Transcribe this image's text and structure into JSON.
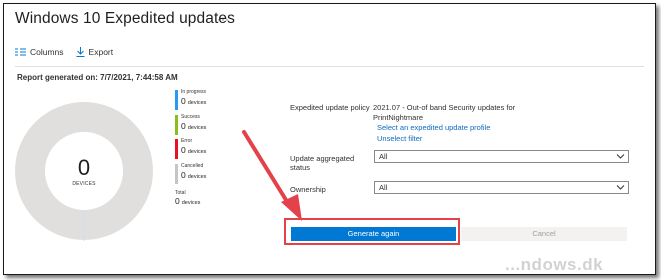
{
  "header": {
    "title": "Windows 10 Expedited updates",
    "more": "···"
  },
  "toolbar": {
    "columns": "Columns",
    "export": "Export"
  },
  "report": {
    "generated": "Report generated on: 7/7/2021, 7:44:58 AM"
  },
  "donut": {
    "total": "0",
    "label": "DEVICES"
  },
  "legend": [
    {
      "name": "In progress",
      "count": "0",
      "unit": "devices",
      "color": "#2899f5"
    },
    {
      "name": "Success",
      "count": "0",
      "unit": "devices",
      "color": "#8cbd18"
    },
    {
      "name": "Error",
      "count": "0",
      "unit": "devices",
      "color": "#e81123"
    },
    {
      "name": "Cancelled",
      "count": "0",
      "unit": "devices",
      "color": "#c8c6c4"
    }
  ],
  "total": {
    "name": "Total",
    "count": "0",
    "unit": "devices"
  },
  "form": {
    "policy_label": "Expedited update policy",
    "policy_value": "2021.07 - Out-of band Security updates for PrintNightmare",
    "select_link": "Select an expedited update profile",
    "unselect_link": "Unselect filter",
    "status_label": "Update aggregated status",
    "status_value": "All",
    "ownership_label": "Ownership",
    "ownership_value": "All"
  },
  "buttons": {
    "generate": "Generate again",
    "cancel": "Cancel"
  },
  "watermark": "...ndows.dk",
  "colors": {
    "accent": "#0078d4",
    "highlight": "#e3424b"
  }
}
